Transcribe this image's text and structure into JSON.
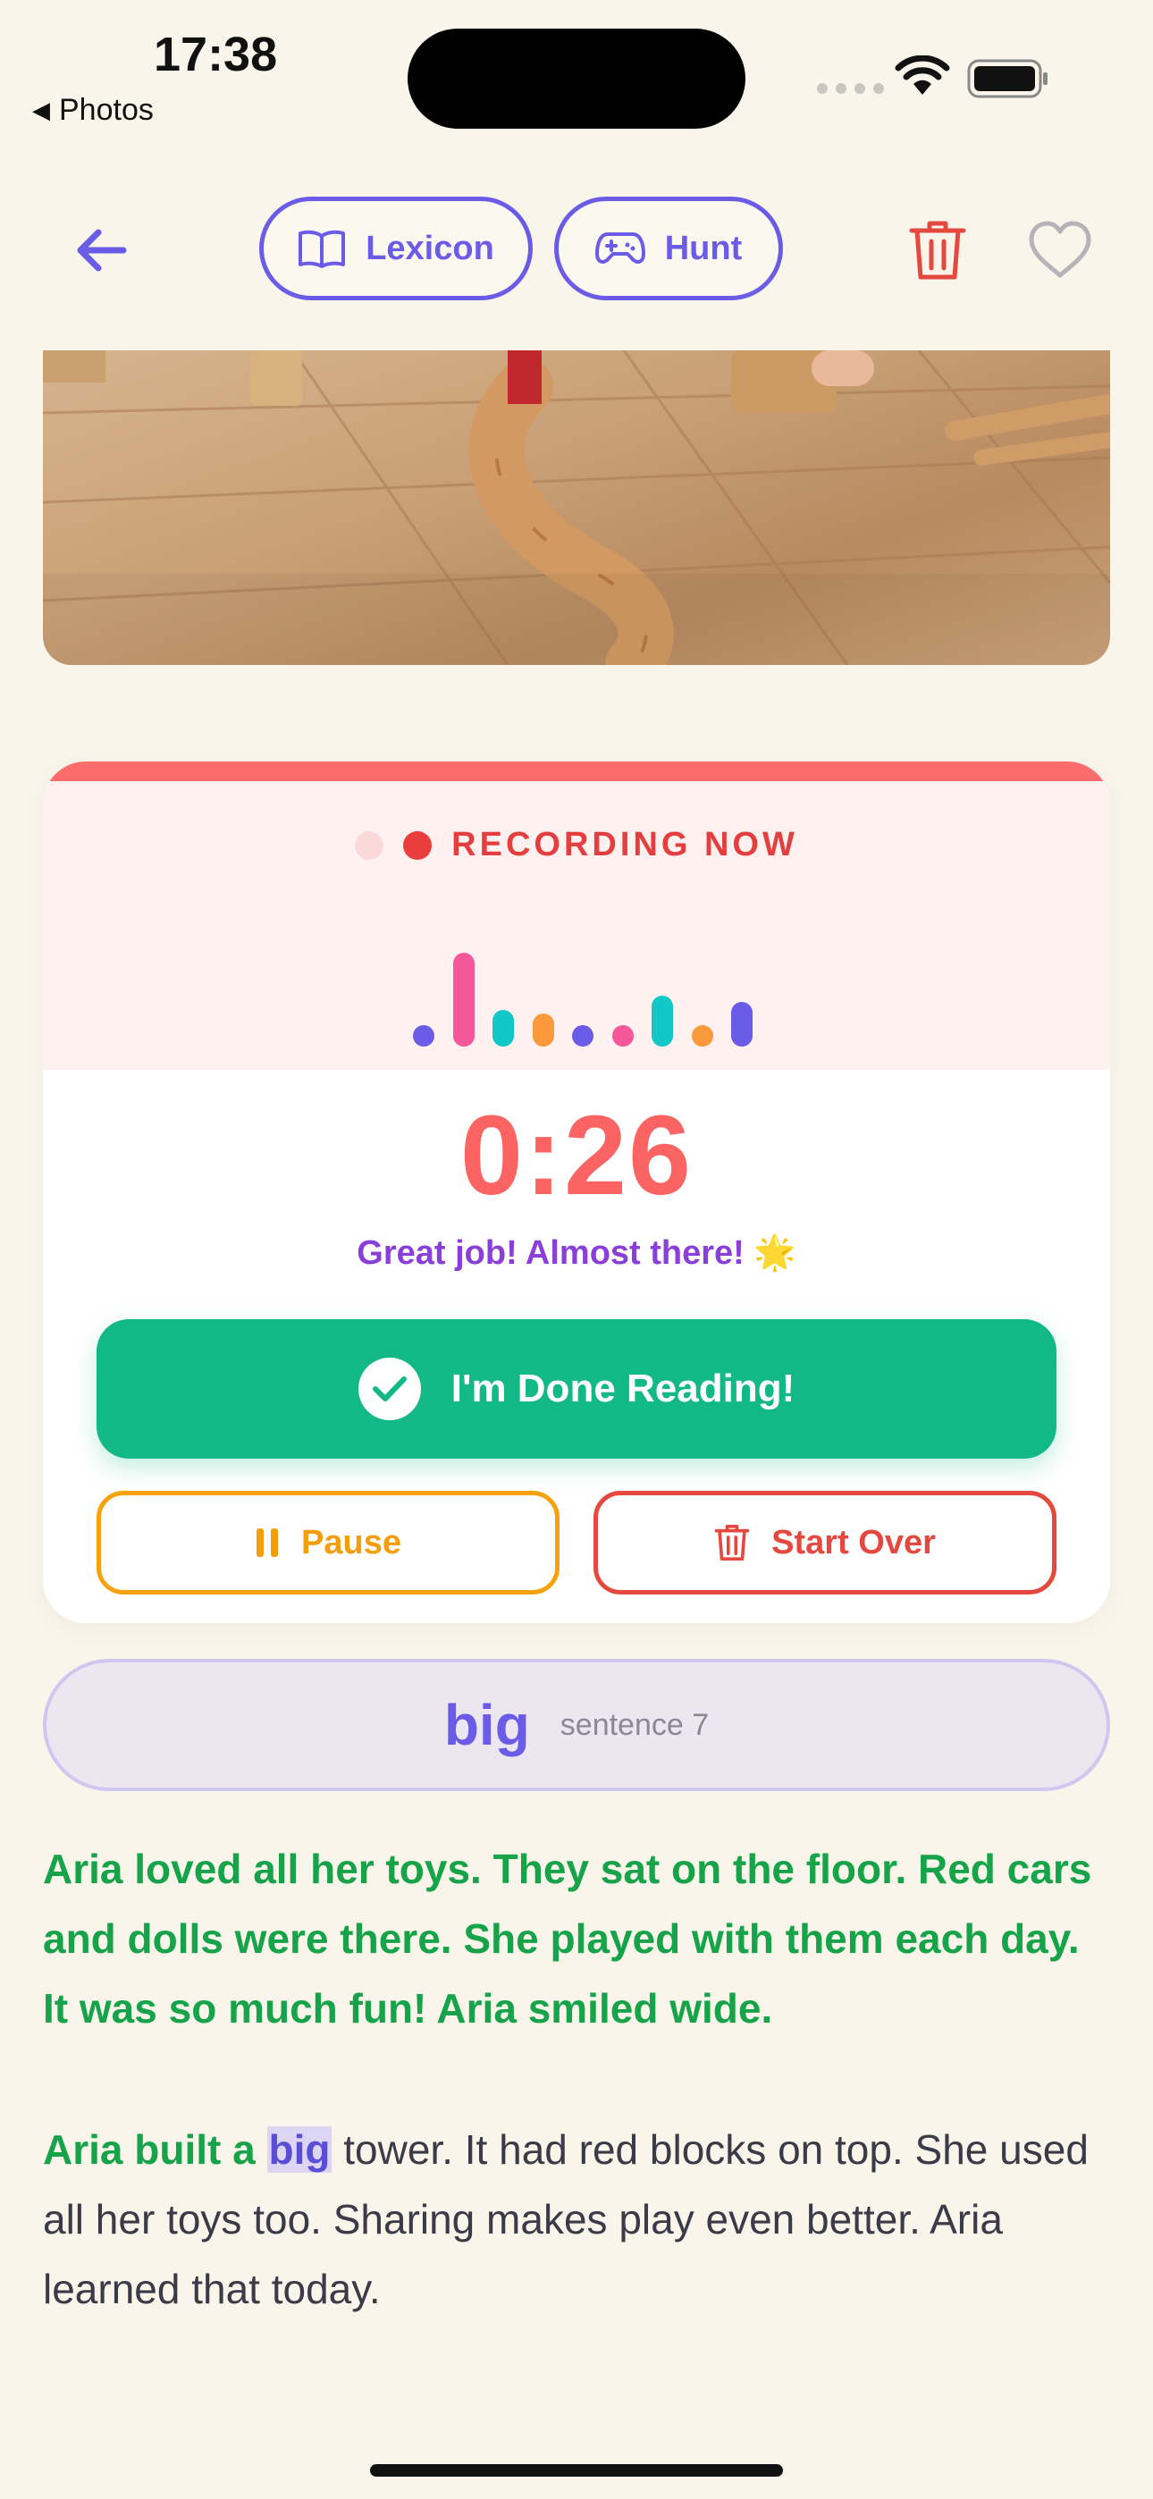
{
  "status_bar": {
    "time": "17:38",
    "back_app": "Photos"
  },
  "nav": {
    "lexicon_label": "Lexicon",
    "hunt_label": "Hunt"
  },
  "recording": {
    "status": "RECORDING NOW",
    "timer": "0:26",
    "encouragement": "Great job! Almost there! 🌟",
    "done_label": "I'm Done Reading!",
    "pause_label": "Pause",
    "start_over_label": "Start Over",
    "level_bars": [
      {
        "level": 0.12,
        "color": "#6b5ce7"
      },
      {
        "level": 0.85,
        "color": "#f4579a"
      },
      {
        "level": 0.33,
        "color": "#12c7c7"
      },
      {
        "level": 0.3,
        "color": "#fb9a3c"
      },
      {
        "level": 0.1,
        "color": "#6b5ce7"
      },
      {
        "level": 0.1,
        "color": "#f4579a"
      },
      {
        "level": 0.46,
        "color": "#12c7c7"
      },
      {
        "level": 0.1,
        "color": "#fb9a3c"
      },
      {
        "level": 0.4,
        "color": "#6b5ce7"
      }
    ]
  },
  "current_word": {
    "word": "big",
    "location": "sentence 7"
  },
  "story": {
    "paragraph1": "Aria loved all her toys. They sat on the floor. Red cars and dolls were there. She played with them each day. It was so much fun! Aria smiled wide.",
    "paragraph2_read": "Aria built a",
    "paragraph2_highlight": "big",
    "paragraph2_rest": " tower. It had red blocks on top. She used all her toys too. Sharing makes play even better. Aria learned that today."
  },
  "colors": {
    "accent": "#6b5ce7",
    "recording_red": "#fb6463",
    "success_green": "#12b886",
    "read_text": "#16a34a",
    "pause_orange": "#f59e0b"
  }
}
